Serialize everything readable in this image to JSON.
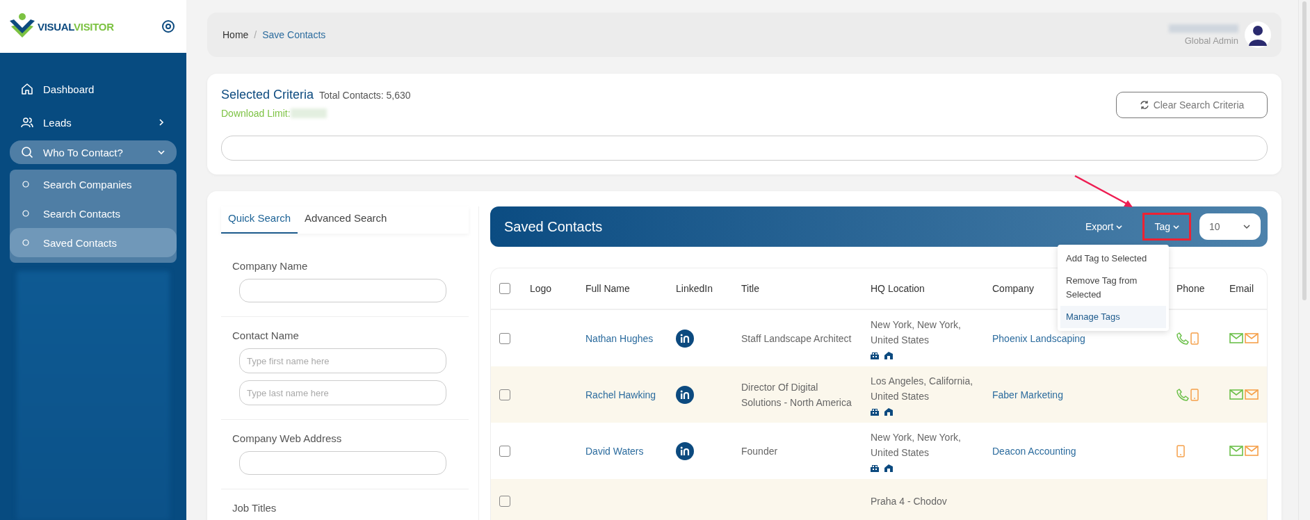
{
  "sidebar": {
    "logo": {
      "first": "VISUAL",
      "second": "VISITOR"
    },
    "items": [
      {
        "label": "Dashboard",
        "kind": "link"
      },
      {
        "label": "Leads",
        "kind": "group",
        "expanded": false
      },
      {
        "label": "Who To Contact?",
        "kind": "group",
        "expanded": true,
        "children": [
          {
            "label": "Search Companies",
            "selected": false
          },
          {
            "label": "Search Contacts",
            "selected": false
          },
          {
            "label": "Saved Contacts",
            "selected": true
          }
        ]
      }
    ]
  },
  "header": {
    "breadcrumb": [
      "Home",
      "Save Contacts"
    ],
    "separator": "/",
    "role": "Global Admin"
  },
  "criteria": {
    "title": "Selected Criteria",
    "total": "Total Contacts: 5,630",
    "download_label": "Download Limit:",
    "clear_button": "Clear Search Criteria"
  },
  "search_panel": {
    "tabs": [
      {
        "label": "Quick Search",
        "selected": true
      },
      {
        "label": "Advanced Search",
        "selected": false
      }
    ],
    "fields": [
      {
        "label": "Company Name",
        "kind": "single"
      },
      {
        "label": "Contact Name",
        "kind": "double",
        "placeholders": [
          "Type first name here",
          "Type last name here"
        ]
      },
      {
        "label": "Company Web Address",
        "kind": "single"
      },
      {
        "label": "Job Titles",
        "kind": "label"
      }
    ]
  },
  "table": {
    "title": "Saved Contacts",
    "actions": [
      {
        "label": "Export",
        "highlighted": false
      },
      {
        "label": "Tag",
        "highlighted": true
      }
    ],
    "page_size": "10",
    "menu": [
      {
        "label": "Add Tag to Selected",
        "selected": false
      },
      {
        "label": "Remove Tag from Selected",
        "selected": false
      },
      {
        "label": "Manage Tags",
        "selected": true
      }
    ],
    "select_all": false,
    "columns": [
      "Logo",
      "Full Name",
      "LinkedIn",
      "Title",
      "HQ Location",
      "Company",
      "Phone",
      "Email"
    ],
    "rows": [
      {
        "checked": false,
        "full_name": "Nathan Hughes",
        "title": "Staff Landscape Architect",
        "location": "New York, New York, United States",
        "company": "Phoenix Landscaping",
        "landline": true
      },
      {
        "checked": false,
        "full_name": "Rachel Hawking",
        "title": "Director Of Digital Solutions - North America",
        "location": "Los Angeles, California, United States",
        "company": "Faber Marketing",
        "landline": true
      },
      {
        "checked": false,
        "full_name": "David Waters",
        "title": "Founder",
        "location": "New York, New York, United States",
        "company": "Deacon Accounting",
        "landline": false
      },
      {
        "checked": false,
        "location": "Praha 4 - Chodov"
      }
    ]
  }
}
